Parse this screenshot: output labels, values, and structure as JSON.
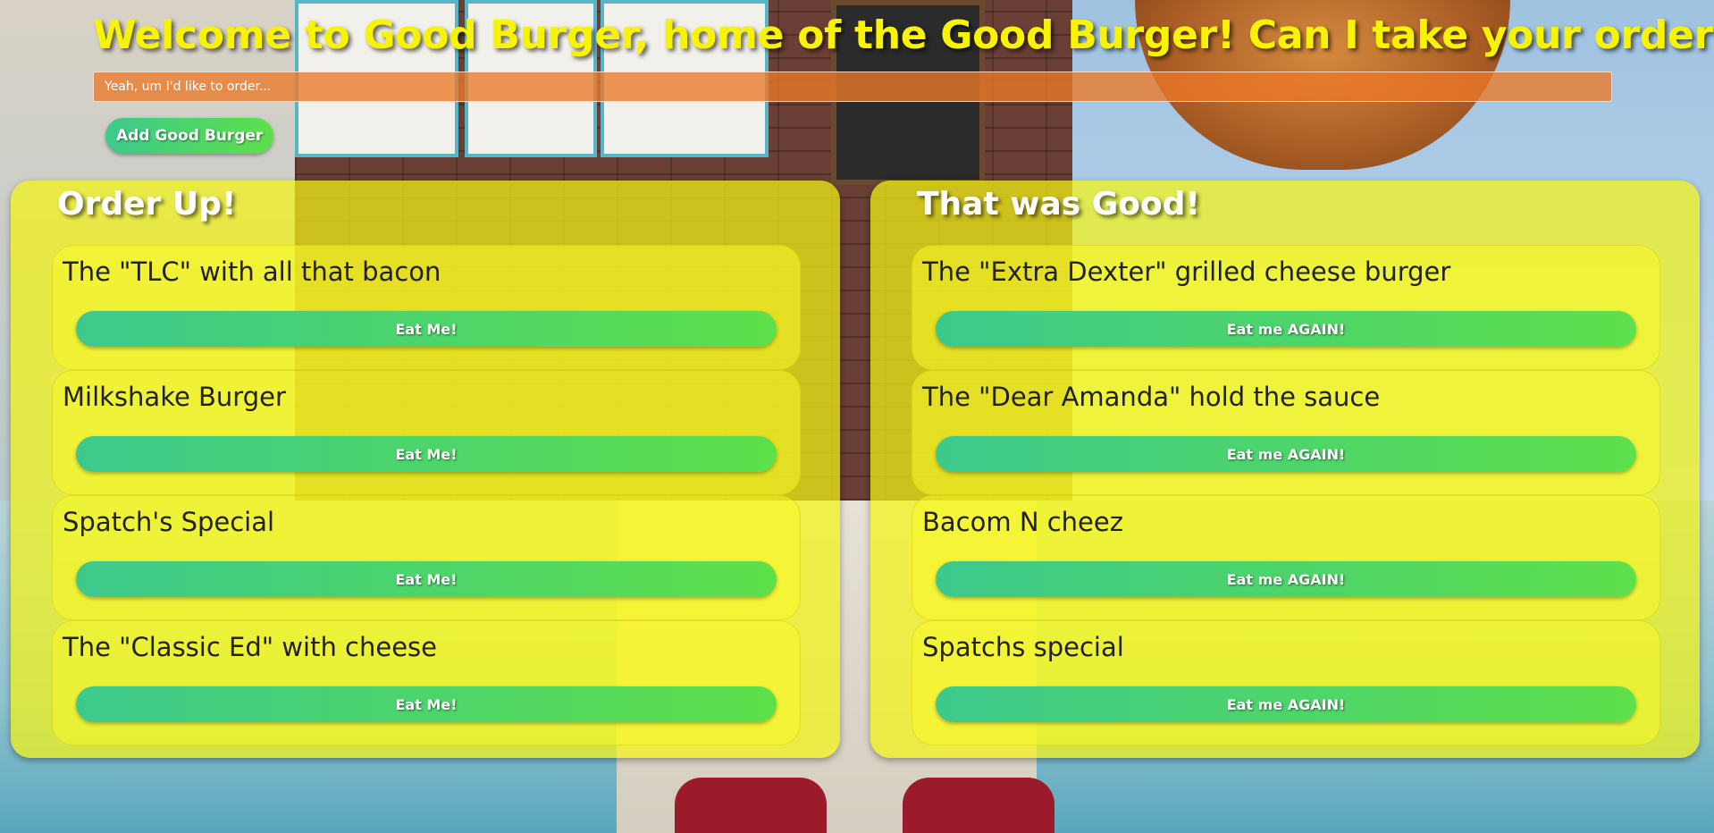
{
  "header": {
    "title": "Welcome to Good Burger, home of the Good Burger! Can I take your order?",
    "input_placeholder": "Yeah, um I'd like to order...",
    "input_value": "",
    "add_button_label": "Add Good Burger"
  },
  "order_up": {
    "heading": "Order Up!",
    "button_label": "Eat Me!",
    "items": [
      {
        "name": "The \"TLC\" with all that bacon"
      },
      {
        "name": "Milkshake Burger"
      },
      {
        "name": "Spatch's Special"
      },
      {
        "name": "The \"Classic Ed\" with cheese"
      }
    ]
  },
  "that_was_good": {
    "heading": "That was Good!",
    "button_label": "Eat me AGAIN!",
    "items": [
      {
        "name": "The \"Extra Dexter\" grilled cheese burger"
      },
      {
        "name": "The \"Dear Amanda\" hold the sauce"
      },
      {
        "name": "Bacom N cheez"
      },
      {
        "name": "Spatchs special"
      }
    ]
  },
  "colors": {
    "title": "#f7f303",
    "panel": "#f4f416",
    "input": "#ec7828",
    "button_start": "#3cc98c",
    "button_end": "#5ee04a"
  }
}
